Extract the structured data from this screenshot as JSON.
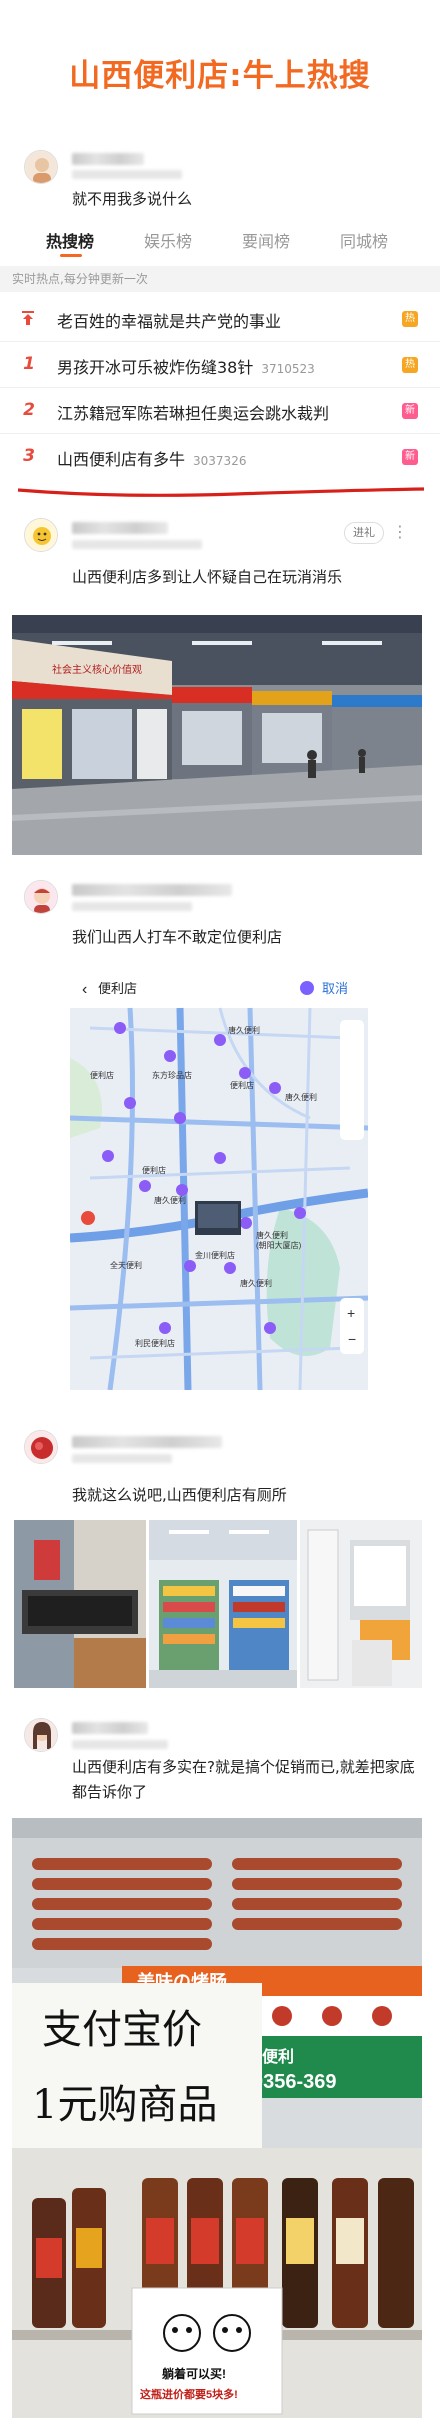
{
  "title": "山西便利店:牛上热搜",
  "post1": {
    "text": "就不用我多说什么"
  },
  "hotsearch": {
    "tabs": [
      "热搜榜",
      "娱乐榜",
      "要闻榜",
      "同城榜"
    ],
    "realtime_label": "实时热点,每分钟更新一次",
    "rows": [
      {
        "rank": "",
        "pinned": true,
        "title": "老百姓的幸福就是共产党的事业",
        "count": "",
        "badge": "热"
      },
      {
        "rank": "1",
        "title": "男孩开冰可乐被炸伤缝38针",
        "count": "3710523",
        "badge": "热"
      },
      {
        "rank": "2",
        "title": "江苏籍冠军陈若琳担任奥运会跳水裁判",
        "count": "",
        "badge": "新"
      },
      {
        "rank": "3",
        "title": "山西便利店有多牛",
        "count": "3037326",
        "badge": "新"
      }
    ]
  },
  "post2": {
    "text": "山西便利店多到让人怀疑自己在玩消消乐",
    "follow_label": "进礼"
  },
  "post3": {
    "text": "我们山西人打车不敢定位便利店"
  },
  "map": {
    "search_text": "便利店",
    "cancel_label": "取消",
    "labels": [
      "便利店",
      "东方珍品店",
      "唐久便利",
      "便利店",
      "唐久便利",
      "便利店",
      "唐久便利",
      "金川便利店",
      "唐久便利",
      "(朝阳大厦店)",
      "唐久便利",
      "利民便利店",
      "全天便利"
    ]
  },
  "post4": {
    "text": "我就这么说吧,山西便利店有厕所"
  },
  "post5": {
    "text": "山西便利店有多实在?就是搞个促销而已,就差把家底都告诉你了"
  },
  "photo_signs": {
    "store_sign": "社会主义核心价值观",
    "sausage_label": "美味の烤肠",
    "phone": "0356-369",
    "store_brand": "便利",
    "promo_line1": "支付宝价",
    "promo_line2": "1元购商品",
    "meme_top": "躺着可以买!",
    "meme_bottom": "这瓶进价都要5块多!"
  },
  "colors": {
    "accent": "#f26a22",
    "rank_red": "#e84a3c",
    "badge_hot": "#f6a623",
    "badge_new": "#ff5d8f",
    "underline": "#d8201a"
  }
}
